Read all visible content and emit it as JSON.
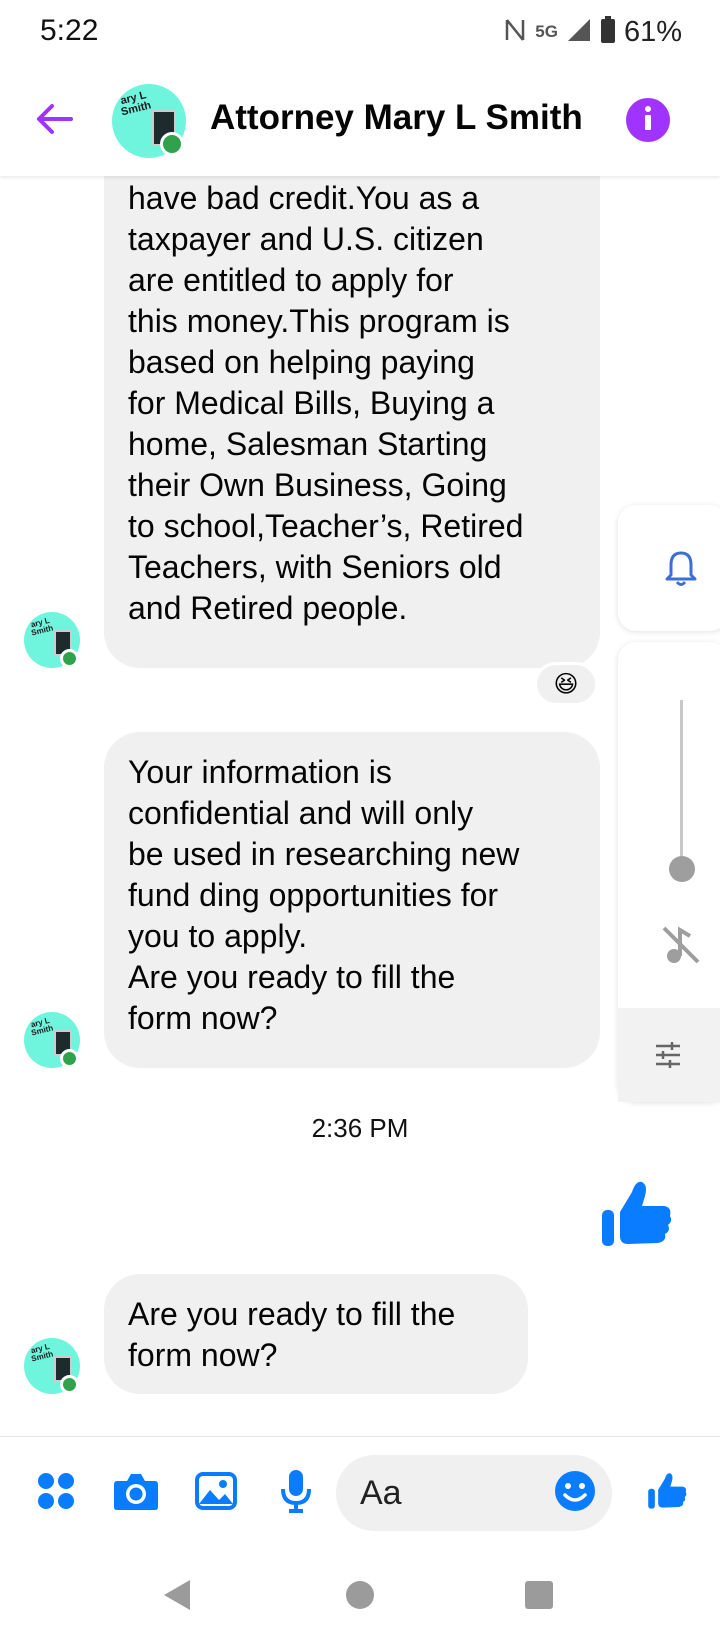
{
  "status_bar": {
    "time": "5:22",
    "network": "5G",
    "battery": "61%"
  },
  "header": {
    "title": "Attorney Mary L Smith",
    "avatar_text": "ary L\nSmith"
  },
  "messages": [
    {
      "text": "have bad credit.You as a\ntaxpayer and U.S. citizen\nare entitled to apply for\nthis money.This program is\nbased on helping paying\nfor Medical Bills, Buying a\nhome, Salesman Starting\ntheir Own Business, Going\nto school,Teacher’s, Retired\nTeachers, with Seniors old\nand Retired people.",
      "reaction": "😆"
    },
    {
      "text": "Your information is\nconfidential and will only\nbe used in researching new\nfund ding opportunities for\nyou to apply.\nAre you ready to fill the\nform now?"
    },
    {
      "text": "Are you ready to fill the\nform now?"
    }
  ],
  "timestamp": "2:36 PM",
  "composer": {
    "placeholder": "Aa"
  },
  "colors": {
    "accent": "#a033ff",
    "messenger_blue": "#0a7cff",
    "bubble_bg": "#f0f0f0",
    "online_green": "#31a24c",
    "avatar_bg": "#6ff5dd"
  },
  "icons": {
    "back": "arrow-left-icon",
    "info": "info-icon",
    "like": "thumbs-up-icon",
    "apps": "four-dots-icon",
    "camera": "camera-icon",
    "gallery": "image-icon",
    "mic": "microphone-icon",
    "emoji": "smiley-icon",
    "bell": "bell-icon",
    "mute": "mute-icon",
    "equalizer": "sliders-icon"
  }
}
